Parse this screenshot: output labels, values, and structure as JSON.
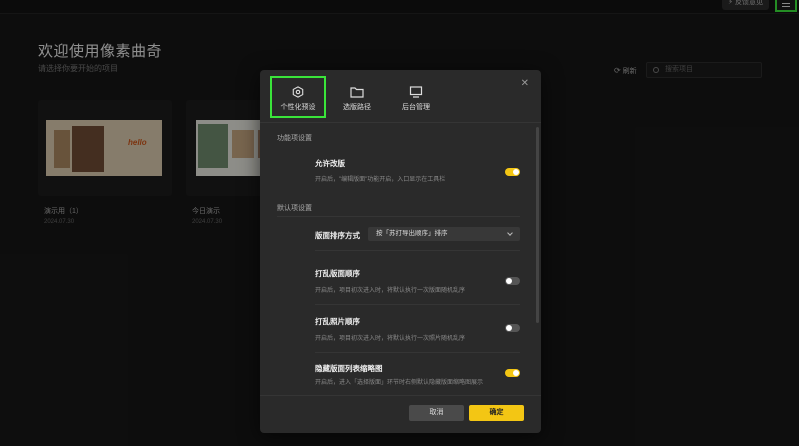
{
  "header": {
    "feedback_label": "⚡ 反馈意见"
  },
  "page": {
    "welcome": "欢迎使用像素曲奇",
    "subtitle": "请选择你要开始的项目",
    "refresh_label": "刷新",
    "search_placeholder": "搜索项目"
  },
  "projects": [
    {
      "name": "演示用（1）",
      "date": "2024.07.30"
    },
    {
      "name": "今日演示",
      "date": "2024.07.30"
    }
  ],
  "modal": {
    "tabs": [
      {
        "label": "个性化预设",
        "icon": "hexagon-gear-icon",
        "active": true
      },
      {
        "label": "选版路径",
        "icon": "folder-icon",
        "active": false
      },
      {
        "label": "后台管理",
        "icon": "monitor-icon",
        "active": false
      }
    ],
    "section_features": "功能项设置",
    "allow_edit": {
      "title": "允许改版",
      "desc": "开启后，\"编辑版面\"功能开启，入口显示在工具栏",
      "on": true
    },
    "section_defaults": "默认项设置",
    "sort": {
      "label": "版面排序方式",
      "value": "按「苏打导出顺序」排序"
    },
    "shuffle_layout": {
      "title": "打乱版面顺序",
      "desc": "开启后，项目初次进入时，将默认执行一次版面随机乱序",
      "on": false
    },
    "shuffle_photos": {
      "title": "打乱照片顺序",
      "desc": "开启后，项目初次进入时，将默认执行一次照片随机乱序",
      "on": false
    },
    "hide_thumbs": {
      "title": "隐藏版面列表缩略图",
      "desc": "开启后，进入「选择版面」环节时右侧默认隐藏版面缩略图展示",
      "on": true
    },
    "cancel_label": "取消",
    "confirm_label": "确定"
  },
  "colors": {
    "accent": "#f3c614",
    "highlight": "#3ae43a"
  }
}
